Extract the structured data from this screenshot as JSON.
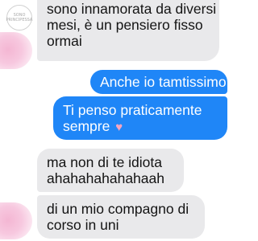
{
  "watermark": "SONO PRINCIPESSA",
  "messages": [
    {
      "direction": "incoming",
      "lines": [
        "sono innamorata da diversi",
        "mesi, è un pensiero fisso",
        "ormai"
      ]
    },
    {
      "direction": "outgoing",
      "lines": [
        "Anche io tamtissimo"
      ]
    },
    {
      "direction": "outgoing",
      "lines": [
        "Ti penso praticamente",
        "sempre"
      ],
      "emoji": "♥"
    },
    {
      "direction": "incoming",
      "lines": [
        "ma non di te idiota",
        "ahahahahahahaah"
      ]
    },
    {
      "direction": "incoming",
      "lines": [
        "di un mio compagno di",
        "corso in uni"
      ]
    }
  ],
  "colors": {
    "incoming_bubble": "#e9e9eb",
    "outgoing_bubble": "#1f86f7",
    "avatar": "#f7c8df",
    "heart": "#f6a5c0"
  },
  "icons": {
    "heart": "heart-icon",
    "avatar": "avatar"
  }
}
